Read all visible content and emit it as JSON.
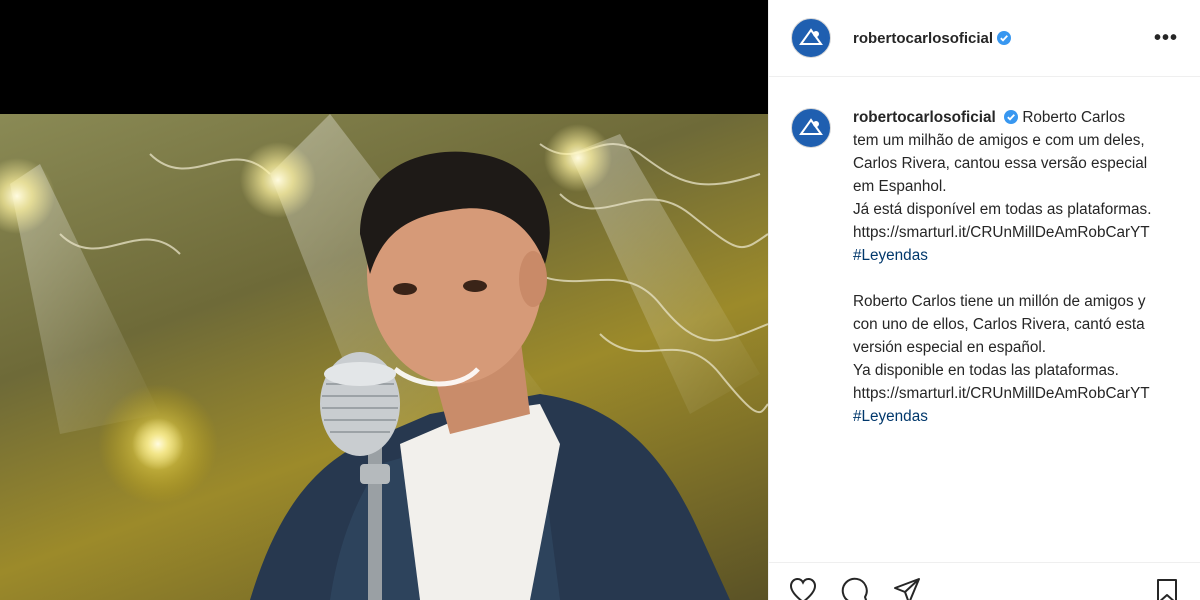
{
  "post": {
    "username": "robertocarlosoficial",
    "more_icon": "more-options-icon",
    "caption": {
      "intro": "Roberto Carlos tem um milhão de amigos e com um deles, Carlos Rivera, cantou essa versão especial em Espanhol.",
      "line2": "Já está disponível em todas as plataformas.",
      "link1": "https://smarturl.it/CRUnMillDeAmRobCarYT",
      "hashtag1": "#Leyendas",
      "es_intro": "Roberto Carlos tiene un millón de amigos y con uno de ellos, Carlos Rivera, cantó esta versión especial en español.",
      "es_line2": "Ya disponible en todas las plataformas.",
      "link2": "https://smarturl.it/CRUnMillDeAmRobCarYT",
      "hashtag2": "#Leyendas"
    }
  },
  "colors": {
    "text": "#262626",
    "hashtag": "#00376b",
    "verified": "#3897f0",
    "avatar_bg": "#1f5fb0",
    "border": "#efefef"
  },
  "icons": [
    "heart-icon",
    "comment-icon",
    "share-icon",
    "save-icon",
    "verified-badge-icon"
  ]
}
